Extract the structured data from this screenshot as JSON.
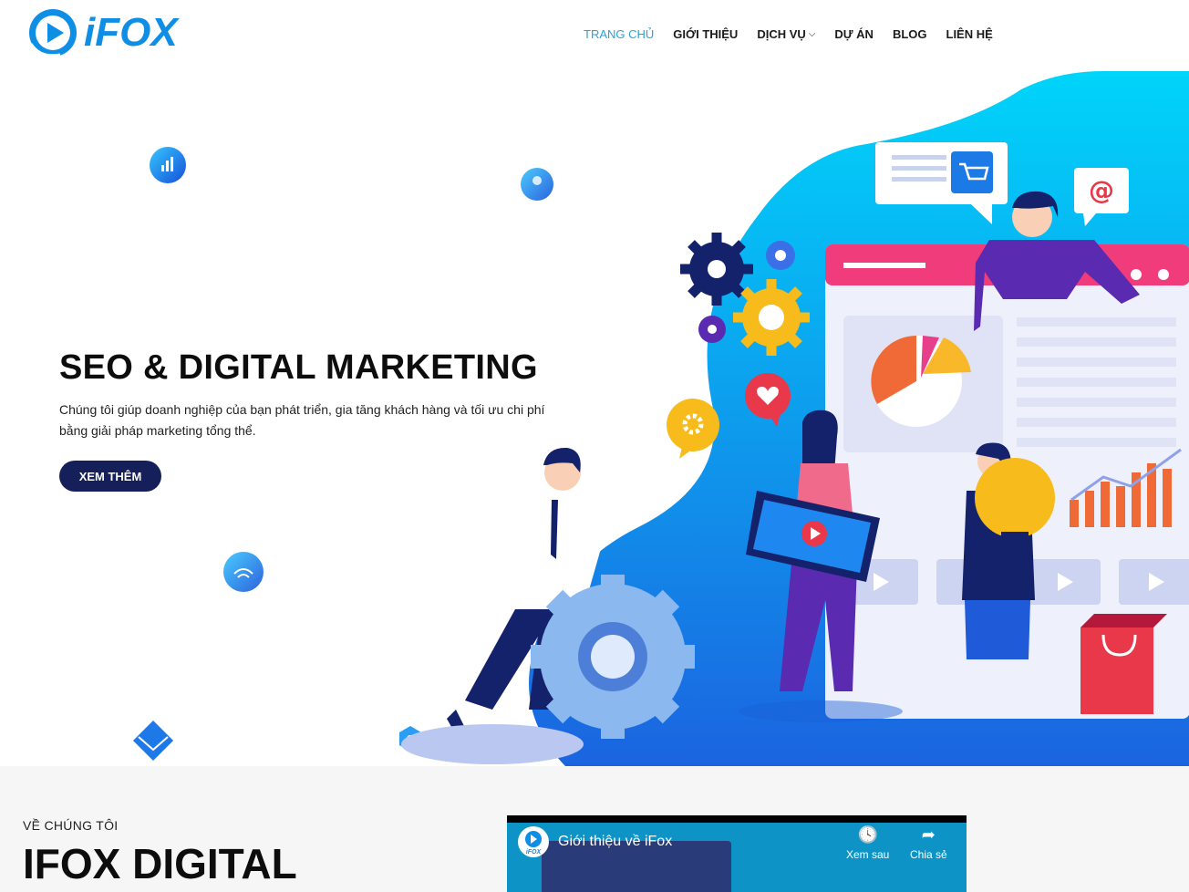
{
  "header": {
    "logo_text": "iFOX",
    "nav": [
      {
        "label": "TRANG CHỦ",
        "active": true
      },
      {
        "label": "GIỚI THIỆU"
      },
      {
        "label": "DỊCH VỤ",
        "has_dropdown": true
      },
      {
        "label": "DỰ ÁN"
      },
      {
        "label": "BLOG"
      },
      {
        "label": "LIÊN HỆ"
      }
    ]
  },
  "hero": {
    "title": "SEO & DIGITAL MARKETING",
    "description": "Chúng tôi giúp doanh nghiệp của bạn phát triển, gia tăng khách hàng và tối ưu chi phí bằng giải pháp marketing tổng thể.",
    "button_label": "XEM THÊM"
  },
  "about": {
    "label": "VỀ CHÚNG TÔI",
    "title": "IFOX DIGITAL",
    "video": {
      "title": "Giới thiệu về iFox",
      "watch_later": "Xem sau",
      "share": "Chia sẻ",
      "channel_logo_text": "iFOX"
    }
  },
  "colors": {
    "brand": "#0f8ee6",
    "nav_active": "#2aa3d9",
    "button": "#15205a",
    "hero_accent": "#00c6f5"
  }
}
